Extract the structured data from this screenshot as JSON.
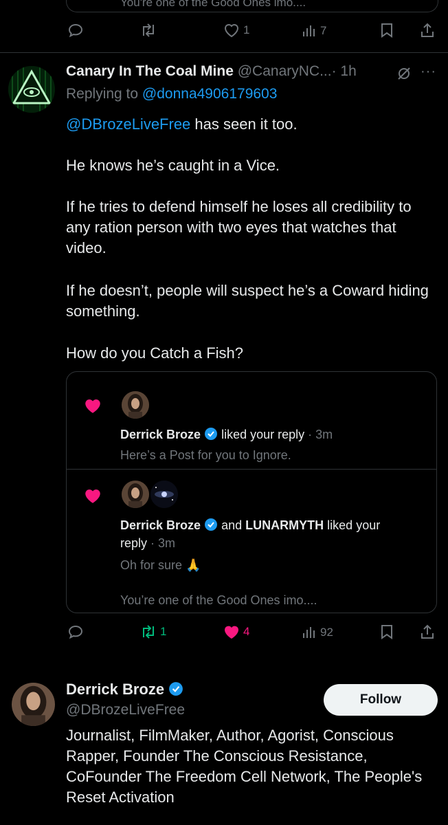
{
  "top_post": {
    "cut_text": "You're one of the Good Ones imo....",
    "likes": "1",
    "views": "7"
  },
  "post": {
    "display_name": "Canary In The Coal Mine",
    "handle": "@CanaryNC...",
    "time": "· 1h",
    "replying_prefix": "Replying to",
    "replying_handle": "@donna4906179603",
    "mention": "@DBrozeLiveFree",
    "line1_rest": " has seen it too.",
    "para2": "He knows he’s caught in a Vice.",
    "para3": "If he tries to defend himself he loses all credibility to any ration person with two eyes that watches that video.",
    "para4": "If he doesn’t, people will suspect he’s a Coward hiding something.",
    "para5": "How do you Catch a Fish?",
    "reposts": "1",
    "likes": "4",
    "views": "92"
  },
  "notif1": {
    "name": "Derrick Broze",
    "action": "liked your reply",
    "time": "· 3m",
    "text": "Here’s a Post for you to Ignore."
  },
  "notif2": {
    "name": "Derrick Broze",
    "and": "and",
    "name2": "LUNARMYTH",
    "action1": "liked your",
    "action2": "reply",
    "time": "· 3m",
    "text": "Oh for sure",
    "emoji": "🙏",
    "text2": "You’re one of the Good Ones imo...."
  },
  "profile": {
    "name": "Derrick Broze",
    "handle": "@DBrozeLiveFree",
    "follow_label": "Follow",
    "bio": "Journalist, FilmMaker, Author, Agorist, Conscious Rapper, Founder The Conscious Resistance, CoFounder The Freedom Cell Network, The People's Reset Activation"
  },
  "colors": {
    "accent": "#1d9bf0",
    "like": "#f91880",
    "repost": "#00ba7c",
    "muted": "#71767b"
  }
}
